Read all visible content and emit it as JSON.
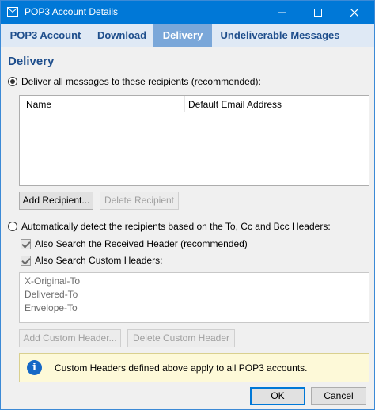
{
  "window": {
    "title": "POP3 Account Details"
  },
  "tabs": [
    {
      "label": "POP3 Account"
    },
    {
      "label": "Download"
    },
    {
      "label": "Delivery"
    },
    {
      "label": "Undeliverable Messages"
    }
  ],
  "section_title": "Delivery",
  "option_recipients": {
    "label": "Deliver all messages to these recipients (recommended):",
    "selected": true
  },
  "recipients_table": {
    "columns": [
      "Name",
      "Default Email Address"
    ],
    "rows": []
  },
  "buttons": {
    "add_recipient": "Add Recipient...",
    "delete_recipient": "Delete Recipient",
    "add_custom_header": "Add Custom Header...",
    "delete_custom_header": "Delete Custom Header",
    "ok": "OK",
    "cancel": "Cancel"
  },
  "option_auto": {
    "label": "Automatically detect the recipients based on the To, Cc and Bcc Headers:",
    "selected": false
  },
  "check_received": {
    "label": "Also Search the Received Header (recommended)",
    "checked": true
  },
  "check_custom": {
    "label": "Also Search Custom Headers:",
    "checked": true
  },
  "custom_headers": [
    "X-Original-To",
    "Delivered-To",
    "Envelope-To"
  ],
  "info_message": "Custom Headers defined above apply to all POP3 accounts.",
  "colors": {
    "titlebar": "#0078d7",
    "tab_active": "#7aa7d9",
    "accent_text": "#1e4e8c",
    "info_bg": "#fdf9d8"
  }
}
